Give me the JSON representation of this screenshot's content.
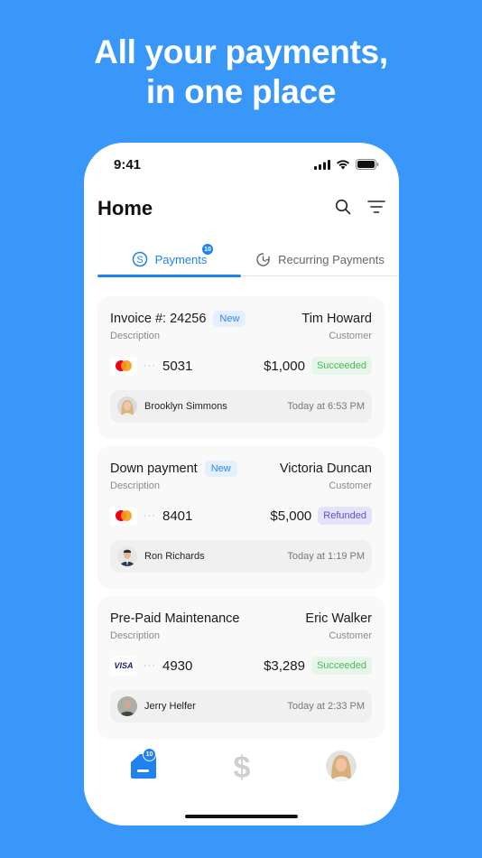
{
  "headline": {
    "line1": "All your payments,",
    "line2": "in one place"
  },
  "status_bar": {
    "time": "9:41"
  },
  "header": {
    "title": "Home"
  },
  "tabs": [
    {
      "label": "Payments",
      "badge": "10",
      "active": true,
      "icon": "dollar-circle-icon"
    },
    {
      "label": "Recurring Payments",
      "active": false,
      "icon": "clock-refresh-icon"
    }
  ],
  "payments": [
    {
      "description": "Invoice #: 24256",
      "new_badge": "New",
      "description_label": "Description",
      "customer": "Tim Howard",
      "customer_label": "Customer",
      "card_brand": "mastercard",
      "card_mask": "···",
      "last4": "5031",
      "amount": "$1,000",
      "status": "Succeeded",
      "rep_name": "Brooklyn Simmons",
      "time": "Today at 6:53 PM"
    },
    {
      "description": "Down payment",
      "new_badge": "New",
      "description_label": "Description",
      "customer": "Victoria Duncan",
      "customer_label": "Customer",
      "card_brand": "mastercard",
      "card_mask": "···",
      "last4": "8401",
      "amount": "$5,000",
      "status": "Refunded",
      "rep_name": "Ron Richards",
      "time": "Today at 1:19 PM"
    },
    {
      "description": "Pre-Paid Maintenance",
      "description_label": "Description",
      "customer": "Eric Walker",
      "customer_label": "Customer",
      "card_brand": "visa",
      "card_brand_label": "VISA",
      "card_mask": "···",
      "last4": "4930",
      "amount": "$3,289",
      "status": "Succeeded",
      "rep_name": "Jerry Helfer",
      "time": "Today at 2:33 PM"
    }
  ],
  "bottom_nav": {
    "home_badge": "10",
    "items": [
      "home-icon",
      "dollar-icon",
      "profile-avatar"
    ]
  },
  "colors": {
    "background": "#3a97fa",
    "accent": "#1f82f0",
    "succeeded": "#4cb85a",
    "refunded": "#5a55c9"
  }
}
